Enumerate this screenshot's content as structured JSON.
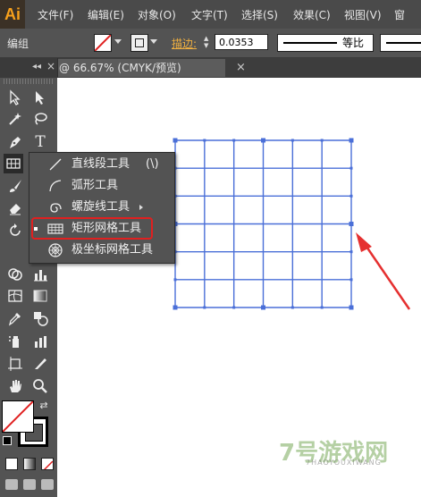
{
  "app": {
    "logo": "Ai"
  },
  "menu": [
    "文件(F)",
    "编辑(E)",
    "对象(O)",
    "文字(T)",
    "选择(S)",
    "效果(C)",
    "视图(V)"
  ],
  "control_bar": {
    "selection_label": "编组",
    "stroke_label": "描边:",
    "stroke_value": "0.0353",
    "profile_label": "等比"
  },
  "document_tab": {
    "title": "@ 66.67% (CMYK/预览)",
    "close_symbol": "×"
  },
  "flyout": {
    "items": [
      {
        "label": "直线段工具",
        "shortcut": "(\\)",
        "icon": "line-segment-icon",
        "selected": false
      },
      {
        "label": "弧形工具",
        "shortcut": "",
        "icon": "arc-icon",
        "selected": false
      },
      {
        "label": "螺旋线工具",
        "shortcut": "",
        "icon": "spiral-icon",
        "selected": false
      },
      {
        "label": "矩形网格工具",
        "shortcut": "",
        "icon": "rectangular-grid-icon",
        "selected": true
      },
      {
        "label": "极坐标网格工具",
        "shortcut": "",
        "icon": "polar-grid-icon",
        "selected": false
      }
    ]
  },
  "grid_object": {
    "columns": 6,
    "rows": 6,
    "stroke_color": "#4a6fd8"
  },
  "annotation": {
    "color": "#e53030"
  },
  "watermark": {
    "text": "7号游戏网",
    "sub": "7HAOYOUXIWANG"
  }
}
